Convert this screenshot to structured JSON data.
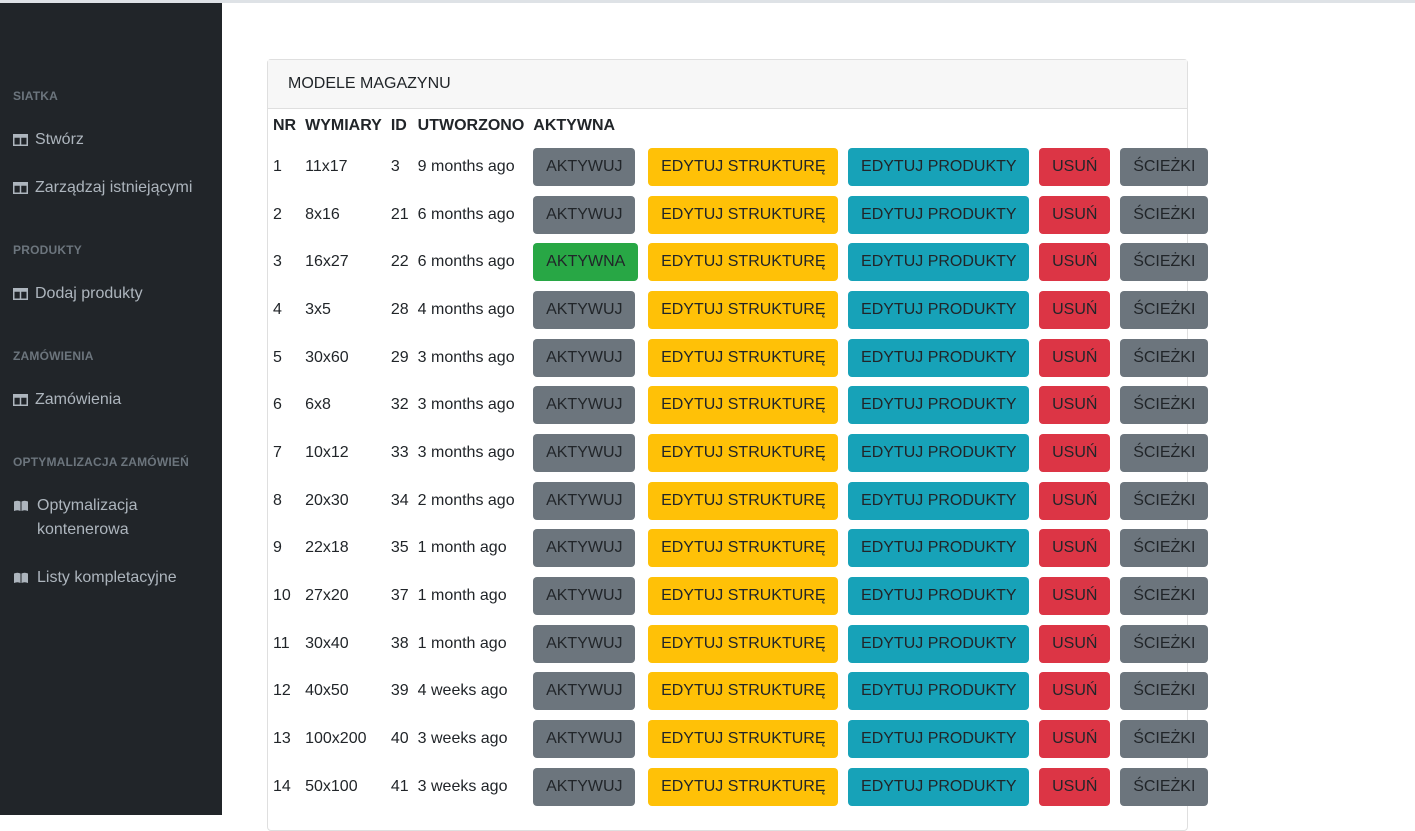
{
  "sidebar": {
    "sections": [
      {
        "title": "SIATKA",
        "items": [
          {
            "label": "Stwórz",
            "icon": "table-icon"
          },
          {
            "label": "Zarządzaj istniejącymi",
            "icon": "table-icon"
          }
        ]
      },
      {
        "title": "PRODUKTY",
        "items": [
          {
            "label": "Dodaj produkty",
            "icon": "table-icon"
          }
        ]
      },
      {
        "title": "ZAMÓWIENIA",
        "items": [
          {
            "label": "Zamówienia",
            "icon": "table-icon"
          }
        ]
      },
      {
        "title": "OPTYMALIZACJA ZAMÓWIEŃ",
        "items": [
          {
            "label": "Optymalizacja kontenerowa",
            "icon": "book-icon"
          },
          {
            "label": "Listy kompletacyjne",
            "icon": "book-icon"
          }
        ]
      }
    ]
  },
  "card": {
    "title": "MODELE MAGAZYNU",
    "columns": [
      "NR",
      "WYMIARY",
      "ID",
      "UTWORZONO",
      "AKTYWNA"
    ],
    "buttons": {
      "activate": "AKTYWUJ",
      "active": "AKTYWNA",
      "edit_structure": "EDYTUJ STRUKTURĘ",
      "edit_products": "EDYTUJ PRODUKTY",
      "delete": "USUŃ",
      "paths": "ŚCIEŻKI"
    },
    "rows": [
      {
        "nr": "1",
        "dims": "11x17",
        "id": "3",
        "created": "9 months ago",
        "active": false
      },
      {
        "nr": "2",
        "dims": "8x16",
        "id": "21",
        "created": "6 months ago",
        "active": false
      },
      {
        "nr": "3",
        "dims": "16x27",
        "id": "22",
        "created": "6 months ago",
        "active": true
      },
      {
        "nr": "4",
        "dims": "3x5",
        "id": "28",
        "created": "4 months ago",
        "active": false
      },
      {
        "nr": "5",
        "dims": "30x60",
        "id": "29",
        "created": "3 months ago",
        "active": false
      },
      {
        "nr": "6",
        "dims": "6x8",
        "id": "32",
        "created": "3 months ago",
        "active": false
      },
      {
        "nr": "7",
        "dims": "10x12",
        "id": "33",
        "created": "3 months ago",
        "active": false
      },
      {
        "nr": "8",
        "dims": "20x30",
        "id": "34",
        "created": "2 months ago",
        "active": false
      },
      {
        "nr": "9",
        "dims": "22x18",
        "id": "35",
        "created": "1 month ago",
        "active": false
      },
      {
        "nr": "10",
        "dims": "27x20",
        "id": "37",
        "created": "1 month ago",
        "active": false
      },
      {
        "nr": "11",
        "dims": "30x40",
        "id": "38",
        "created": "1 month ago",
        "active": false
      },
      {
        "nr": "12",
        "dims": "40x50",
        "id": "39",
        "created": "4 weeks ago",
        "active": false
      },
      {
        "nr": "13",
        "dims": "100x200",
        "id": "40",
        "created": "3 weeks ago",
        "active": false
      },
      {
        "nr": "14",
        "dims": "50x100",
        "id": "41",
        "created": "3 weeks ago",
        "active": false
      }
    ]
  },
  "colors": {
    "sidebar_bg": "#212529",
    "activate": "#6c757d",
    "active": "#28a745",
    "edit_structure": "#ffc107",
    "edit_products": "#17a2b8",
    "delete": "#dc3545",
    "paths": "#6c757d"
  }
}
